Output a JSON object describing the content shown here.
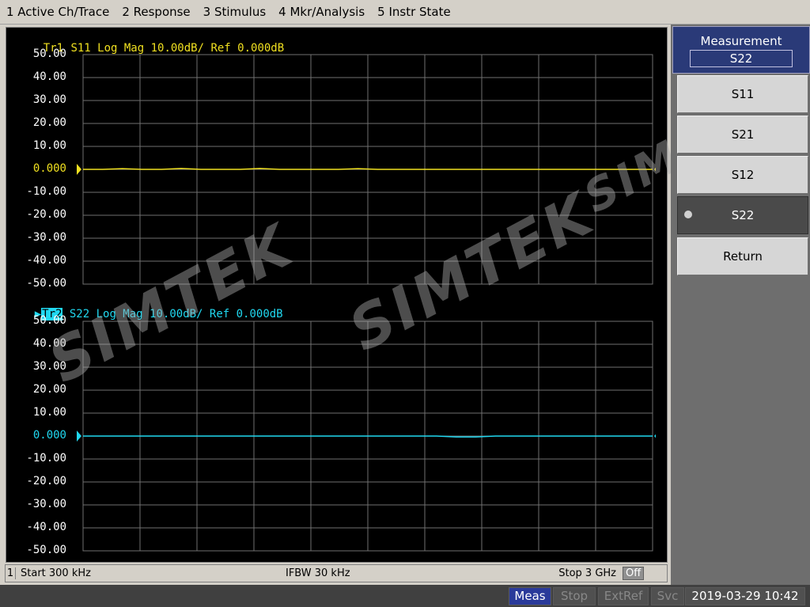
{
  "menu": [
    "1 Active Ch/Trace",
    "2 Response",
    "3 Stimulus",
    "4 Mkr/Analysis",
    "5 Instr State"
  ],
  "colors": {
    "trace1": "#f0e020",
    "trace2": "#20d8f0",
    "grid": "#707070"
  },
  "traces": [
    {
      "tag": "Tr1",
      "header": " S11 Log Mag 10.00dB/ Ref 0.000dB",
      "color": "#f0e020"
    },
    {
      "tag": "Tr2",
      "header": " S22 Log Mag 10.00dB/ Ref 0.000dB",
      "color": "#20d8f0"
    }
  ],
  "y_ticks": [
    "50.00",
    "40.00",
    "30.00",
    "20.00",
    "10.00",
    "0.000",
    "-10.00",
    "-20.00",
    "-30.00",
    "-40.00",
    "-50.00"
  ],
  "status": {
    "channel": "1",
    "start": "Start 300 kHz",
    "ifbw": "IFBW 30 kHz",
    "stop": "Stop 3 GHz",
    "off": "Off"
  },
  "indicators": {
    "meas": "Meas",
    "stop": "Stop",
    "extref": "ExtRef",
    "svc": "Svc",
    "datetime": "2019-03-29 10:42"
  },
  "softkeys": {
    "title": "Measurement",
    "current": "S22",
    "items": [
      "S11",
      "S21",
      "S12",
      "S22"
    ],
    "selected": "S22",
    "return": "Return"
  },
  "watermark": "SIMTEK",
  "chart_data": [
    {
      "type": "line",
      "series": [
        {
          "values": [
            0,
            0,
            0.3,
            0,
            0,
            0.4,
            0,
            0,
            0,
            0.4,
            0,
            0,
            0,
            0,
            0.3,
            0,
            0,
            0,
            0,
            0,
            0,
            0,
            0,
            0,
            0,
            0,
            0,
            0,
            0,
            0
          ]
        }
      ],
      "ylim": [
        -50,
        50
      ],
      "grid": true
    },
    {
      "type": "line",
      "series": [
        {
          "values": [
            0,
            0,
            0,
            0,
            0,
            0,
            0,
            0,
            0,
            0,
            0,
            0,
            0,
            0,
            0,
            0,
            0,
            0,
            0,
            -0.4,
            -0.4,
            0,
            0,
            0,
            0,
            0,
            0,
            0,
            0,
            0
          ]
        }
      ],
      "ylim": [
        -50,
        50
      ],
      "grid": true
    }
  ]
}
